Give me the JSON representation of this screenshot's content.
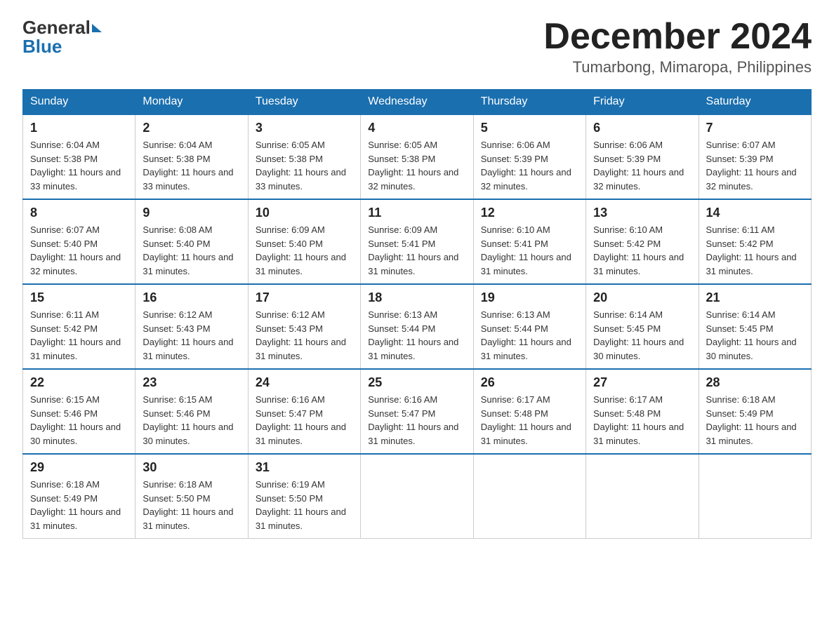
{
  "logo": {
    "line1": "General",
    "arrow": true,
    "line2": "Blue"
  },
  "title": "December 2024",
  "location": "Tumarbong, Mimaropa, Philippines",
  "weekdays": [
    "Sunday",
    "Monday",
    "Tuesday",
    "Wednesday",
    "Thursday",
    "Friday",
    "Saturday"
  ],
  "weeks": [
    [
      {
        "day": "1",
        "sunrise": "6:04 AM",
        "sunset": "5:38 PM",
        "daylight": "11 hours and 33 minutes."
      },
      {
        "day": "2",
        "sunrise": "6:04 AM",
        "sunset": "5:38 PM",
        "daylight": "11 hours and 33 minutes."
      },
      {
        "day": "3",
        "sunrise": "6:05 AM",
        "sunset": "5:38 PM",
        "daylight": "11 hours and 33 minutes."
      },
      {
        "day": "4",
        "sunrise": "6:05 AM",
        "sunset": "5:38 PM",
        "daylight": "11 hours and 32 minutes."
      },
      {
        "day": "5",
        "sunrise": "6:06 AM",
        "sunset": "5:39 PM",
        "daylight": "11 hours and 32 minutes."
      },
      {
        "day": "6",
        "sunrise": "6:06 AM",
        "sunset": "5:39 PM",
        "daylight": "11 hours and 32 minutes."
      },
      {
        "day": "7",
        "sunrise": "6:07 AM",
        "sunset": "5:39 PM",
        "daylight": "11 hours and 32 minutes."
      }
    ],
    [
      {
        "day": "8",
        "sunrise": "6:07 AM",
        "sunset": "5:40 PM",
        "daylight": "11 hours and 32 minutes."
      },
      {
        "day": "9",
        "sunrise": "6:08 AM",
        "sunset": "5:40 PM",
        "daylight": "11 hours and 31 minutes."
      },
      {
        "day": "10",
        "sunrise": "6:09 AM",
        "sunset": "5:40 PM",
        "daylight": "11 hours and 31 minutes."
      },
      {
        "day": "11",
        "sunrise": "6:09 AM",
        "sunset": "5:41 PM",
        "daylight": "11 hours and 31 minutes."
      },
      {
        "day": "12",
        "sunrise": "6:10 AM",
        "sunset": "5:41 PM",
        "daylight": "11 hours and 31 minutes."
      },
      {
        "day": "13",
        "sunrise": "6:10 AM",
        "sunset": "5:42 PM",
        "daylight": "11 hours and 31 minutes."
      },
      {
        "day": "14",
        "sunrise": "6:11 AM",
        "sunset": "5:42 PM",
        "daylight": "11 hours and 31 minutes."
      }
    ],
    [
      {
        "day": "15",
        "sunrise": "6:11 AM",
        "sunset": "5:42 PM",
        "daylight": "11 hours and 31 minutes."
      },
      {
        "day": "16",
        "sunrise": "6:12 AM",
        "sunset": "5:43 PM",
        "daylight": "11 hours and 31 minutes."
      },
      {
        "day": "17",
        "sunrise": "6:12 AM",
        "sunset": "5:43 PM",
        "daylight": "11 hours and 31 minutes."
      },
      {
        "day": "18",
        "sunrise": "6:13 AM",
        "sunset": "5:44 PM",
        "daylight": "11 hours and 31 minutes."
      },
      {
        "day": "19",
        "sunrise": "6:13 AM",
        "sunset": "5:44 PM",
        "daylight": "11 hours and 31 minutes."
      },
      {
        "day": "20",
        "sunrise": "6:14 AM",
        "sunset": "5:45 PM",
        "daylight": "11 hours and 30 minutes."
      },
      {
        "day": "21",
        "sunrise": "6:14 AM",
        "sunset": "5:45 PM",
        "daylight": "11 hours and 30 minutes."
      }
    ],
    [
      {
        "day": "22",
        "sunrise": "6:15 AM",
        "sunset": "5:46 PM",
        "daylight": "11 hours and 30 minutes."
      },
      {
        "day": "23",
        "sunrise": "6:15 AM",
        "sunset": "5:46 PM",
        "daylight": "11 hours and 30 minutes."
      },
      {
        "day": "24",
        "sunrise": "6:16 AM",
        "sunset": "5:47 PM",
        "daylight": "11 hours and 31 minutes."
      },
      {
        "day": "25",
        "sunrise": "6:16 AM",
        "sunset": "5:47 PM",
        "daylight": "11 hours and 31 minutes."
      },
      {
        "day": "26",
        "sunrise": "6:17 AM",
        "sunset": "5:48 PM",
        "daylight": "11 hours and 31 minutes."
      },
      {
        "day": "27",
        "sunrise": "6:17 AM",
        "sunset": "5:48 PM",
        "daylight": "11 hours and 31 minutes."
      },
      {
        "day": "28",
        "sunrise": "6:18 AM",
        "sunset": "5:49 PM",
        "daylight": "11 hours and 31 minutes."
      }
    ],
    [
      {
        "day": "29",
        "sunrise": "6:18 AM",
        "sunset": "5:49 PM",
        "daylight": "11 hours and 31 minutes."
      },
      {
        "day": "30",
        "sunrise": "6:18 AM",
        "sunset": "5:50 PM",
        "daylight": "11 hours and 31 minutes."
      },
      {
        "day": "31",
        "sunrise": "6:19 AM",
        "sunset": "5:50 PM",
        "daylight": "11 hours and 31 minutes."
      },
      null,
      null,
      null,
      null
    ]
  ]
}
